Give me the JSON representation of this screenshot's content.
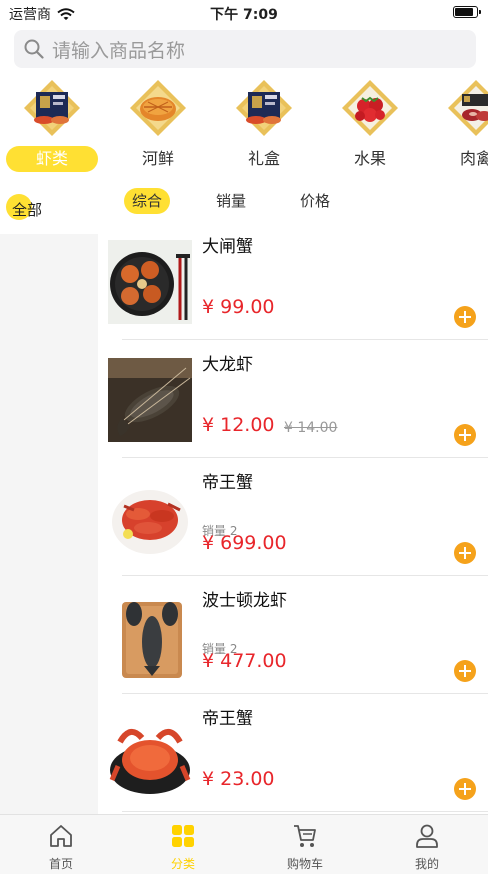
{
  "status_bar": {
    "carrier": "运营商",
    "time": "下午 7:09",
    "battery_level": 0.9
  },
  "search": {
    "placeholder": "请输入商品名称"
  },
  "categories": [
    {
      "label": "虾类",
      "active": true,
      "icon": "gift-box-thumbnail"
    },
    {
      "label": "河鲜",
      "active": false,
      "icon": "fried-fish-thumbnail"
    },
    {
      "label": "礼盒",
      "active": false,
      "icon": "gift-box-thumbnail"
    },
    {
      "label": "水果",
      "active": false,
      "icon": "strawberry-thumbnail"
    },
    {
      "label": "肉禽",
      "active": false,
      "icon": "meat-box-thumbnail"
    }
  ],
  "sidebar": {
    "items": [
      {
        "label": "全部",
        "active": true
      }
    ]
  },
  "sort_tabs": [
    {
      "label": "综合",
      "active": true
    },
    {
      "label": "销量",
      "active": false
    },
    {
      "label": "价格",
      "active": false
    }
  ],
  "products": [
    {
      "name": "大闸蟹",
      "sales": "",
      "price": "¥ 99.00",
      "old_price": "",
      "image": "crabs-on-plate-image"
    },
    {
      "name": "大龙虾",
      "sales": "",
      "price": "¥ 12.00",
      "old_price": "¥ 14.00",
      "image": "lobster-image"
    },
    {
      "name": "帝王蟹",
      "sales": "销量 2",
      "price": "¥ 699.00",
      "old_price": "",
      "image": "king-crab-legs-image"
    },
    {
      "name": "波士顿龙虾",
      "sales": "销量 2",
      "price": "¥ 477.00",
      "old_price": "",
      "image": "boston-lobster-image"
    },
    {
      "name": "帝王蟹",
      "sales": "",
      "price": "¥ 23.00",
      "old_price": "",
      "image": "king-crab-image"
    }
  ],
  "tab_bar": [
    {
      "label": "首页",
      "active": false,
      "icon": "home-icon"
    },
    {
      "label": "分类",
      "active": true,
      "icon": "category-grid-icon"
    },
    {
      "label": "购物车",
      "active": false,
      "icon": "cart-icon"
    },
    {
      "label": "我的",
      "active": false,
      "icon": "user-icon"
    }
  ],
  "colors": {
    "accent_yellow": "#ffe033",
    "price_red": "#e8262b",
    "add_orange": "#f5a21b",
    "tab_active": "#ffd200"
  }
}
